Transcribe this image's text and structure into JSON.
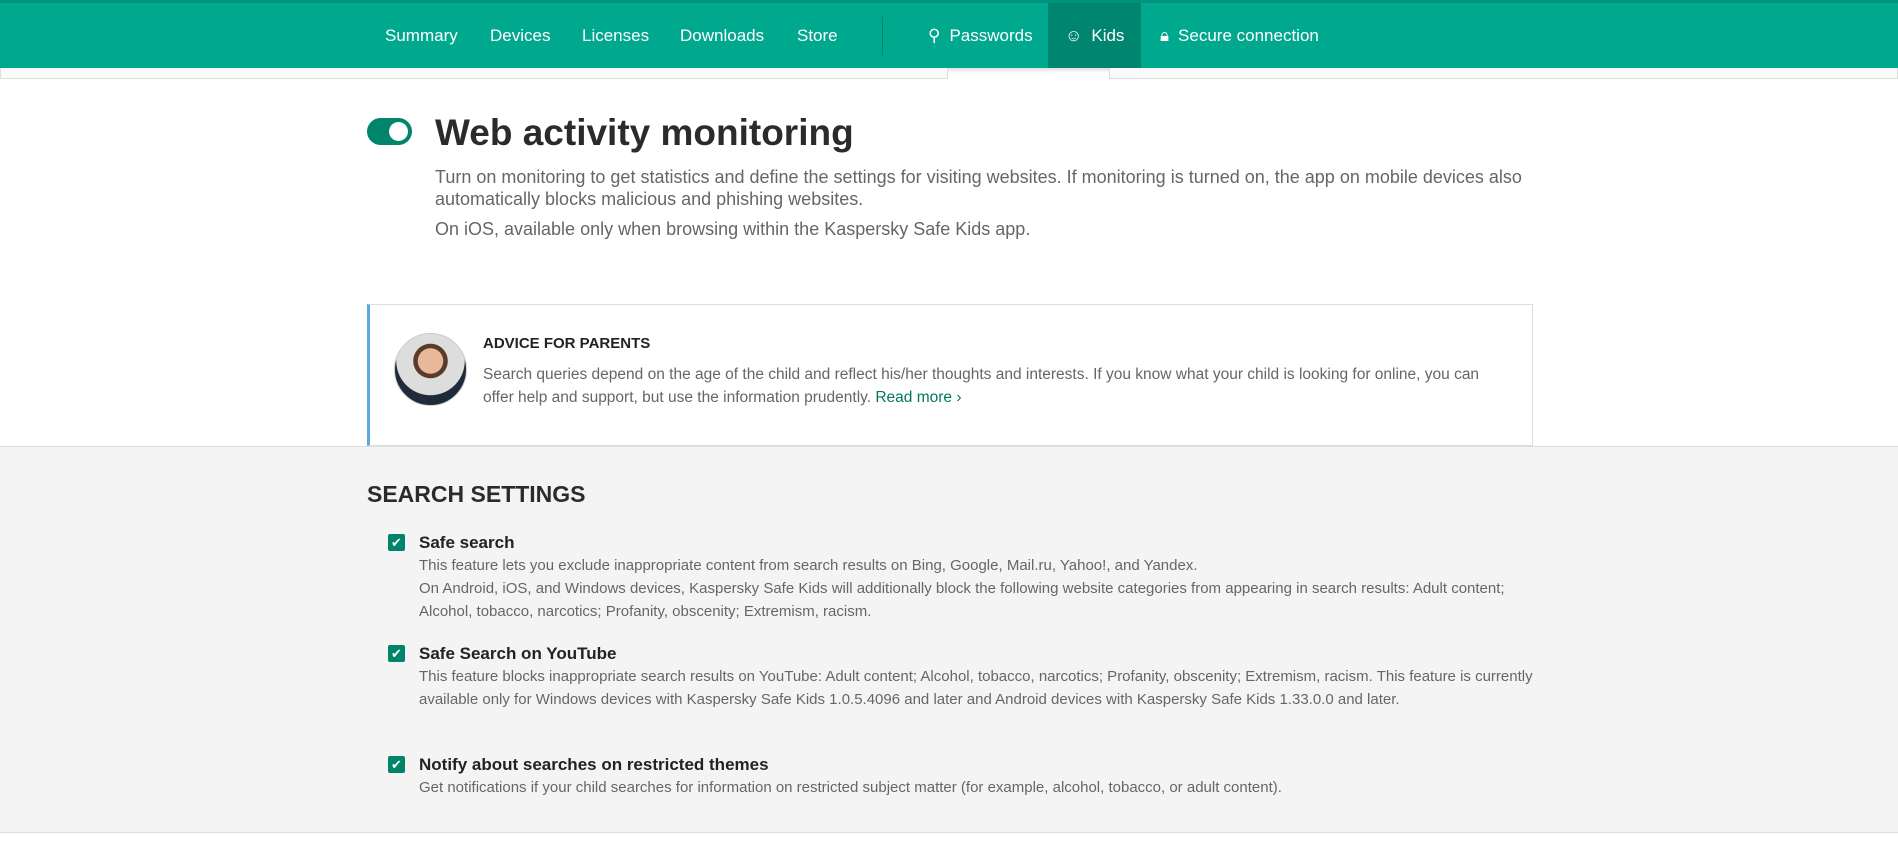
{
  "nav": {
    "items": [
      "Summary",
      "Devices",
      "Licenses",
      "Downloads",
      "Store"
    ],
    "passwords": "Passwords",
    "kids": "Kids",
    "secure": "Secure connection"
  },
  "monitoring": {
    "enabled": true,
    "title": "Web activity monitoring",
    "desc1": "Turn on monitoring to get statistics and define the settings for visiting websites. If monitoring is turned on, the app on mobile devices also automatically blocks malicious and phishing websites.",
    "desc2": "On iOS, available only when browsing within the Kaspersky Safe Kids app."
  },
  "advice": {
    "title": "ADVICE FOR PARENTS",
    "text": "Search queries depend on the age of the child and reflect his/her thoughts and interests. If you know what your child is looking for online, you can offer help and support, but use the information prudently. ",
    "link": "Read more ›"
  },
  "search": {
    "heading": "SEARCH SETTINGS",
    "items": [
      {
        "checked": true,
        "title": "Safe search",
        "desc": [
          "This feature lets you exclude inappropriate content from search results on Bing, Google, Mail.ru, Yahoo!, and Yandex.",
          "On Android, iOS, and Windows devices, Kaspersky Safe Kids will additionally block the following website categories from appearing in search results: Adult content; Alcohol, tobacco, narcotics; Profanity, obscenity; Extremism, racism."
        ]
      },
      {
        "checked": true,
        "title": "Safe Search on YouTube",
        "desc": [
          "This feature blocks inappropriate search results on YouTube: Adult content; Alcohol, tobacco, narcotics; Profanity, obscenity; Extremism, racism. This feature is currently available only for Windows devices with Kaspersky Safe Kids 1.0.5.4096 and later and Android devices with Kaspersky Safe Kids 1.33.0.0 and later."
        ]
      },
      {
        "checked": true,
        "title": "Notify about searches on restricted themes",
        "desc": [
          "Get notifications if your child searches for information on restricted subject matter (for example, alcohol, tobacco, or adult content)."
        ]
      }
    ]
  }
}
